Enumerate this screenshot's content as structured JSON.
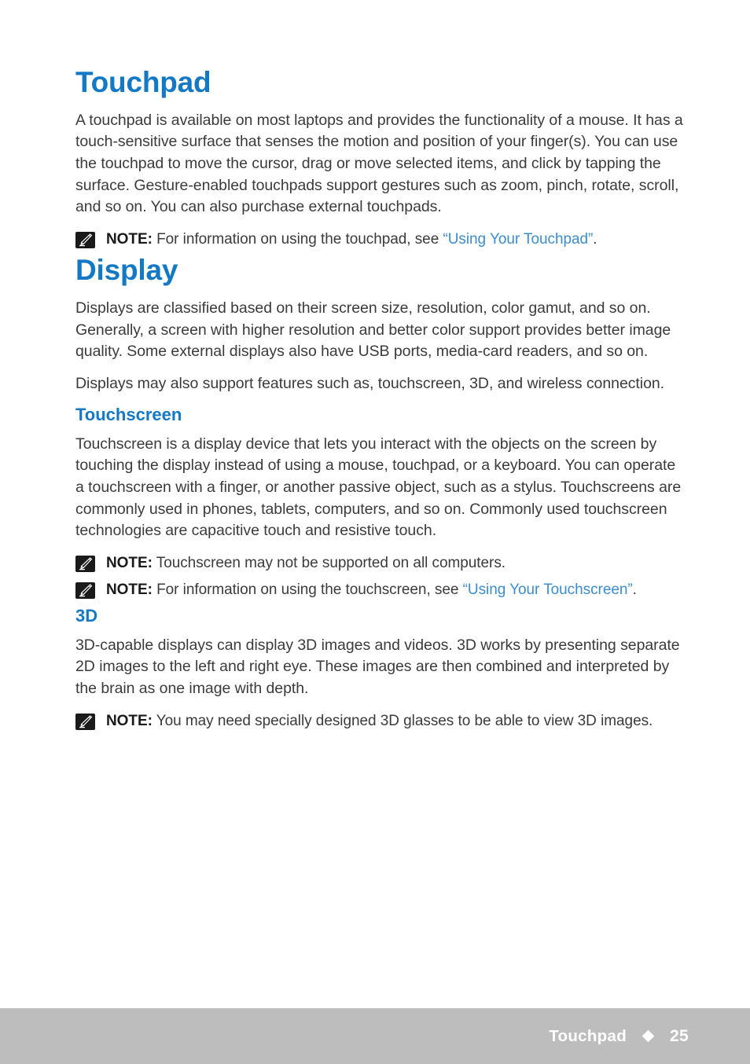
{
  "page": {
    "accent_color": "#1479c4",
    "link_color": "#3d8dcc",
    "body_color": "#3b3b3b",
    "footer_bg": "#bdbdbd"
  },
  "sections": {
    "touchpad": {
      "heading": "Touchpad",
      "paragraph": "A touchpad is available on most laptops and provides the functionality of a mouse. It has a touch-sensitive surface that senses the motion and position of your finger(s). You can use the touchpad to move the cursor, drag or move selected items, and click by tapping the surface. Gesture-enabled touchpads support gestures such as zoom, pinch, rotate, scroll, and so on. You can also purchase external touchpads.",
      "note": {
        "label": "NOTE:",
        "text_before": " For information on using the touchpad, see ",
        "link": "“Using Your Touchpad”",
        "text_after": "."
      }
    },
    "display": {
      "heading": "Display",
      "paragraph_1": "Displays are classified based on their screen size, resolution, color gamut, and so on. Generally, a screen with higher resolution and better color support provides better image quality. Some external displays also have USB ports, media-card readers, and so on.",
      "paragraph_2": "Displays may also support features such as, touchscreen, 3D, and wireless connection."
    },
    "touchscreen": {
      "heading": "Touchscreen",
      "paragraph": "Touchscreen is a display device that lets you interact with the objects on the screen by touching the display instead of using a mouse, touchpad, or a keyboard. You can operate a touchscreen with a finger, or another passive object, such as a stylus. Touchscreens are commonly used in phones, tablets, computers, and so on. Commonly used touchscreen technologies are capacitive touch and resistive touch.",
      "note_1": {
        "label": "NOTE:",
        "text_before": " Touchscreen may not be supported on all computers.",
        "link": "",
        "text_after": ""
      },
      "note_2": {
        "label": "NOTE:",
        "text_before": " For information on using the touchscreen, see ",
        "link": "“Using Your Touchscreen”",
        "text_after": "."
      }
    },
    "threed": {
      "heading": "3D",
      "paragraph": "3D-capable displays can display 3D images and videos. 3D works by presenting separate 2D images to the left and right eye. These images are then combined and interpreted by the brain as one image with depth.",
      "note": {
        "label": "NOTE:",
        "text_before": " You may need specially designed 3D glasses to be able to view 3D images.",
        "link": "",
        "text_after": ""
      }
    }
  },
  "footer": {
    "chapter": "Touchpad",
    "separator_icon": "diamond-bullet",
    "page_number": "25"
  },
  "icons": {
    "note": "pencil-icon"
  }
}
